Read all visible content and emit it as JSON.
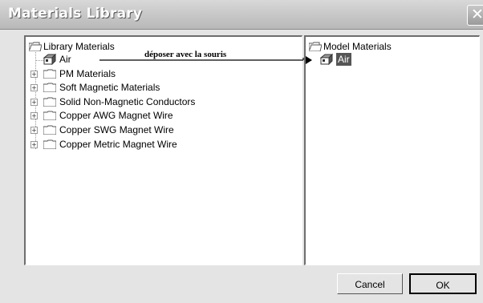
{
  "window": {
    "title": "Materials Library"
  },
  "library": {
    "root": "Library Materials",
    "items": [
      {
        "label": "Air",
        "icon": "material-icon"
      },
      {
        "label": "PM Materials",
        "icon": "folder-icon"
      },
      {
        "label": "Soft Magnetic Materials",
        "icon": "folder-icon"
      },
      {
        "label": "Solid Non-Magnetic Conductors",
        "icon": "folder-icon"
      },
      {
        "label": "Copper AWG Magnet Wire",
        "icon": "folder-icon"
      },
      {
        "label": "Copper SWG Magnet Wire",
        "icon": "folder-icon"
      },
      {
        "label": "Copper Metric Magnet Wire",
        "icon": "folder-icon"
      }
    ]
  },
  "model": {
    "root": "Model Materials",
    "items": [
      {
        "label": "Air",
        "icon": "material-icon",
        "selected": true
      }
    ]
  },
  "annotation": {
    "text": "déposer avec la souris"
  },
  "buttons": {
    "cancel": "Cancel",
    "ok": "OK"
  }
}
